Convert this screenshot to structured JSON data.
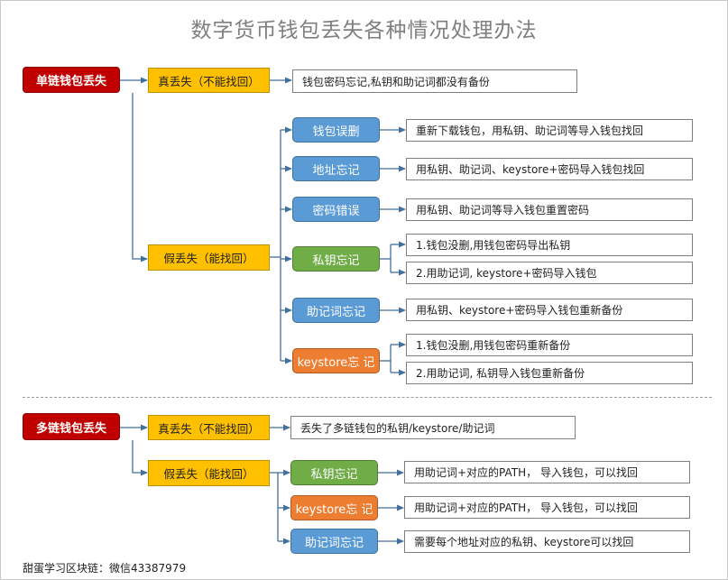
{
  "title": "数字货币钱包丢失各种情况处理办法",
  "section1": {
    "root": "单链钱包丢失",
    "real_loss": "真丢失（不能找回）",
    "real_loss_detail": "钱包密码忘记,私钥和助记词都没有备份",
    "fake_loss": "假丢失（能找回）",
    "cases": [
      {
        "label": "钱包误删",
        "detail": "重新下载钱包，用私钥、助记词等导入钱包找回"
      },
      {
        "label": "地址忘记",
        "detail": "用私钥、助记词、keystore+密码导入钱包找回"
      },
      {
        "label": "密码错误",
        "detail": "用私钥、助记词等导入钱包重置密码"
      },
      {
        "label": "私钥忘记",
        "detail_a": "1.钱包没删,用钱包密码导出私钥",
        "detail_b": "2.用助记词, keystore+密码导入钱包"
      },
      {
        "label": "助记词忘记",
        "detail": "用私钥、keystore+密码导入钱包重新备份"
      },
      {
        "label": "keystore忘 记",
        "detail_a": "1.钱包没删,用钱包密码重新备份",
        "detail_b": "2.用助记词, 私钥导入钱包重新备份"
      }
    ]
  },
  "section2": {
    "root": "多链钱包丢失",
    "real_loss": "真丢失（不能找回）",
    "real_loss_detail": "丢失了多链钱包的私钥/keystore/助记词",
    "fake_loss": "假丢失（能找回）",
    "cases": [
      {
        "label": "私钥忘记",
        "detail": "用助记词+对应的PATH， 导入钱包，可以找回"
      },
      {
        "label": "keystore忘 记",
        "detail": "用助记词+对应的PATH， 导入钱包，可以找回"
      },
      {
        "label": "助记词忘记",
        "detail": "需要每个地址对应的私钥、keystore可以找回"
      }
    ]
  },
  "footer": "甜蛋学习区块链：微信43387979",
  "colors": {
    "root": "#c00000",
    "category": "#ffc000",
    "case_blue": "#5b9bd5",
    "case_green": "#70ad47",
    "case_orange": "#ed7d31",
    "connector": "#41719c"
  }
}
